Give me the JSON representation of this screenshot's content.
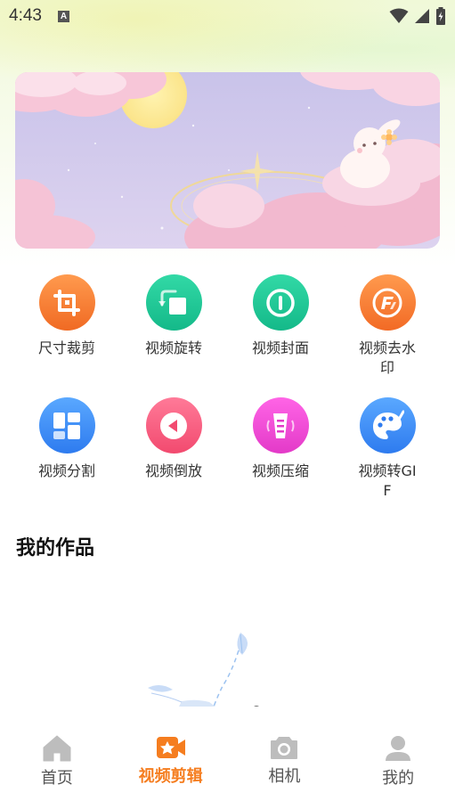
{
  "status_bar": {
    "time": "4:43",
    "notification_icon": "A"
  },
  "tools": [
    {
      "label": "尺寸裁剪",
      "icon": "crop-icon"
    },
    {
      "label": "视频旋转",
      "icon": "rotate-icon"
    },
    {
      "label": "视频封面",
      "icon": "cover-icon"
    },
    {
      "label": "视频去水印",
      "icon": "watermark-remove-icon"
    },
    {
      "label": "视频分割",
      "icon": "split-icon"
    },
    {
      "label": "视频倒放",
      "icon": "reverse-icon"
    },
    {
      "label": "视频压缩",
      "icon": "compress-icon"
    },
    {
      "label": "视频转GIF",
      "icon": "gif-icon"
    }
  ],
  "works_section": {
    "title": "我的作品"
  },
  "bottom_nav": {
    "items": [
      {
        "label": "首页",
        "icon": "home-icon",
        "active": false
      },
      {
        "label": "视频剪辑",
        "icon": "video-edit-icon",
        "active": true
      },
      {
        "label": "相机",
        "icon": "camera-icon",
        "active": false
      },
      {
        "label": "我的",
        "icon": "profile-icon",
        "active": false
      }
    ],
    "active_color": "#f57d1f",
    "inactive_color": "#9b9b9b"
  }
}
